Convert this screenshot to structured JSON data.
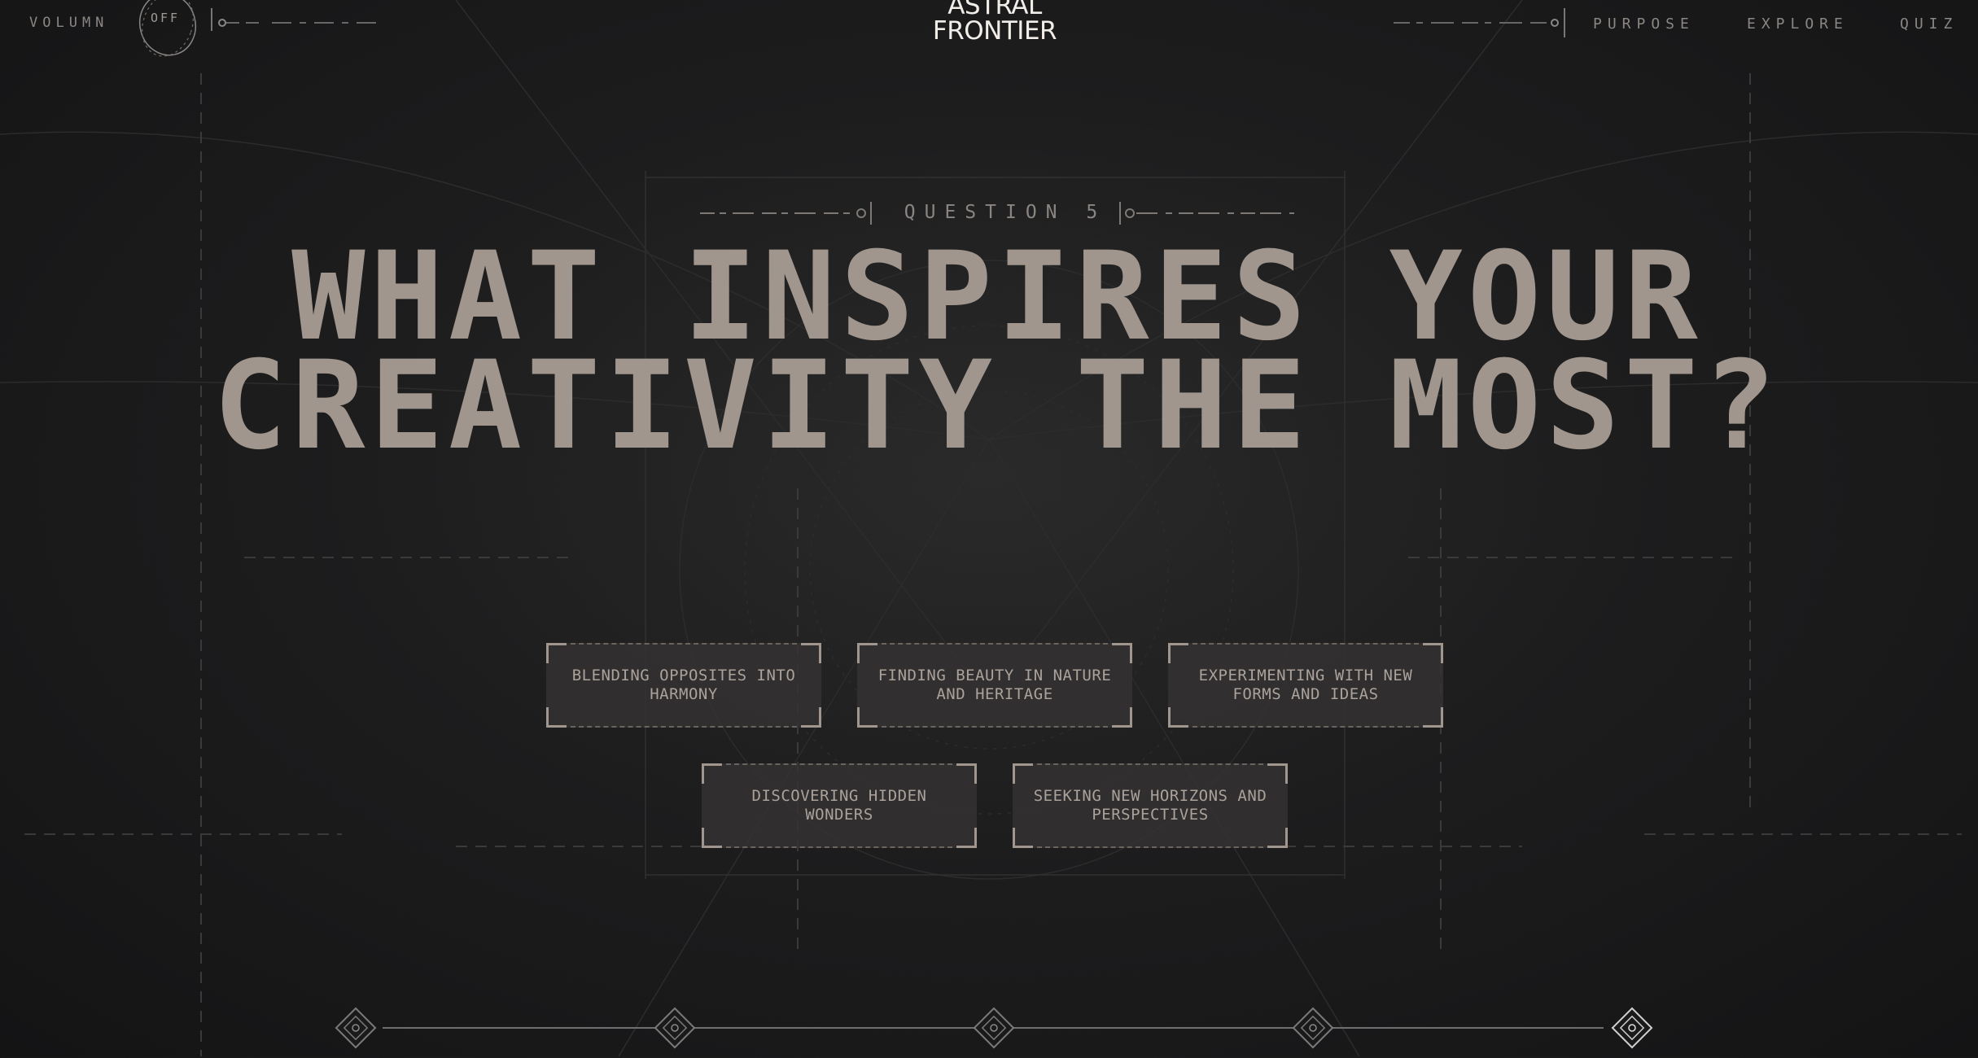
{
  "header": {
    "volume_label": "VOLUMN",
    "volume_state": "OFF",
    "brand": "ASTRAL FRONTIER",
    "nav": [
      {
        "label": "PURPOSE"
      },
      {
        "label": "EXPLORE"
      },
      {
        "label": "QUIZ"
      }
    ]
  },
  "quiz": {
    "question_label": "QUESTION 5",
    "question": "WHAT INSPIRES YOUR CREATIVITY THE MOST?",
    "answers": [
      {
        "label": "BLENDING OPPOSITES INTO HARMONY"
      },
      {
        "label": "FINDING BEAUTY IN NATURE AND HERITAGE"
      },
      {
        "label": "EXPERIMENTING WITH NEW FORMS AND IDEAS"
      },
      {
        "label": "DISCOVERING HIDDEN WONDERS"
      },
      {
        "label": "SEEKING NEW HORIZONS AND PERSPECTIVES"
      }
    ],
    "progress": {
      "current_step": 5,
      "total_steps": 5
    }
  },
  "colors": {
    "background": "#1a1a1b",
    "text_primary": "#a0968d",
    "brand": "#f1ede8",
    "frame": "#a0968d"
  }
}
